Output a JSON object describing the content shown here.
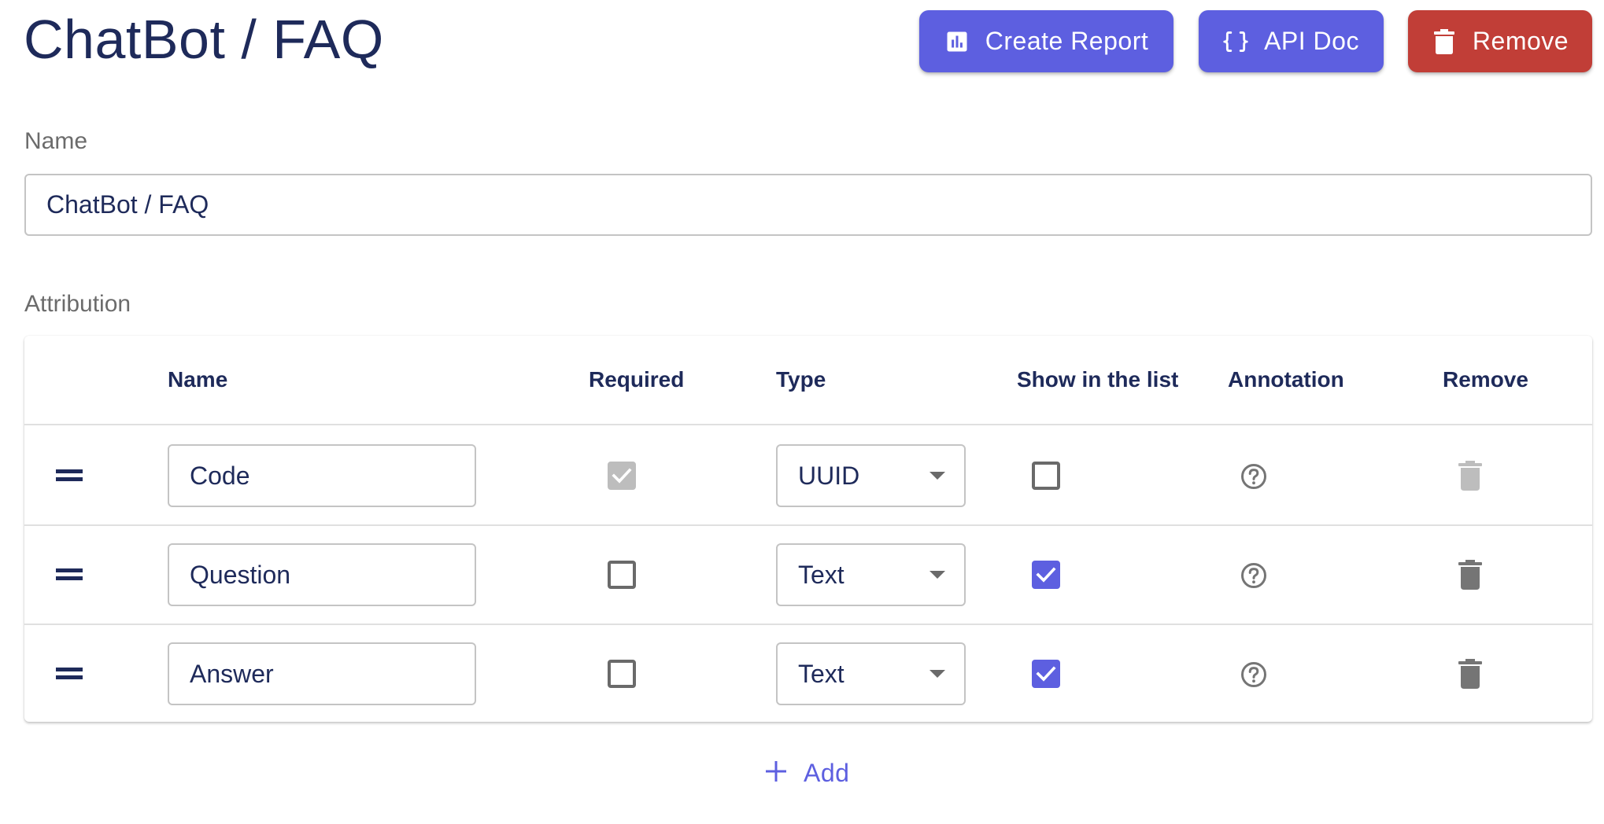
{
  "page": {
    "title": "ChatBot / FAQ"
  },
  "toolbar": {
    "create_report_label": "Create Report",
    "create_report_icon": "bar-chart-icon",
    "api_doc_label": "API Doc",
    "api_doc_icon": "curly-braces-icon",
    "remove_label": "Remove",
    "remove_icon": "trash-icon"
  },
  "name_field": {
    "label": "Name",
    "value": "ChatBot / FAQ"
  },
  "attribution": {
    "label": "Attribution",
    "columns": [
      "",
      "Name",
      "Required",
      "Type",
      "Show in the list",
      "Annotation",
      "Remove"
    ],
    "rows": [
      {
        "name": "Code",
        "required": true,
        "required_disabled": true,
        "type": "UUID",
        "show_in_list": false,
        "annotation_icon": "help-circle-icon",
        "remove_disabled": true
      },
      {
        "name": "Question",
        "required": false,
        "required_disabled": false,
        "type": "Text",
        "show_in_list": true,
        "annotation_icon": "help-circle-icon",
        "remove_disabled": false
      },
      {
        "name": "Answer",
        "required": false,
        "required_disabled": false,
        "type": "Text",
        "show_in_list": true,
        "annotation_icon": "help-circle-icon",
        "remove_disabled": false
      }
    ],
    "add_label": "Add"
  },
  "colors": {
    "primary": "#5d5fe0",
    "danger": "#c13e37",
    "text": "#1e2a5a",
    "muted": "#6b6b6b",
    "disabled": "#bdbdbd",
    "icon_gray": "#757575"
  }
}
